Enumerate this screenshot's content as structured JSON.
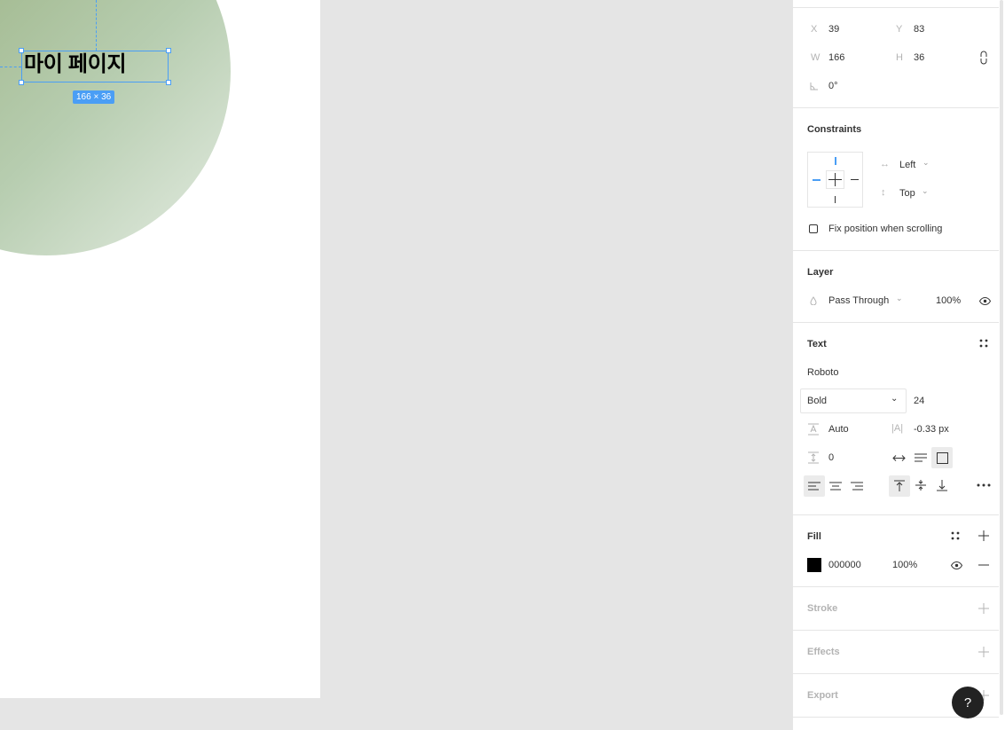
{
  "canvas": {
    "selected_text": "마이 페이지",
    "dimension_label": "166 × 36",
    "colors": {
      "selection": "#4a9ef5",
      "canvas_bg": "#e5e5e5"
    }
  },
  "design": {
    "x_label": "X",
    "x_value": "39",
    "y_label": "Y",
    "y_value": "83",
    "w_label": "W",
    "w_value": "166",
    "h_label": "H",
    "h_value": "36",
    "rotation_value": "0°"
  },
  "constraints": {
    "title": "Constraints",
    "horizontal": "Left",
    "vertical": "Top",
    "fix_scroll_label": "Fix position when scrolling"
  },
  "layer": {
    "title": "Layer",
    "blend_mode": "Pass Through",
    "opacity": "100%"
  },
  "text": {
    "title": "Text",
    "font_family": "Roboto",
    "font_weight": "Bold",
    "font_size": "24",
    "line_height": "Auto",
    "letter_spacing": "-0.33 px",
    "paragraph_spacing": "0"
  },
  "fill": {
    "title": "Fill",
    "hex": "000000",
    "opacity": "100%",
    "color": "#000000"
  },
  "stroke": {
    "title": "Stroke"
  },
  "effects": {
    "title": "Effects"
  },
  "export": {
    "title": "Export"
  },
  "help": {
    "label": "?"
  }
}
